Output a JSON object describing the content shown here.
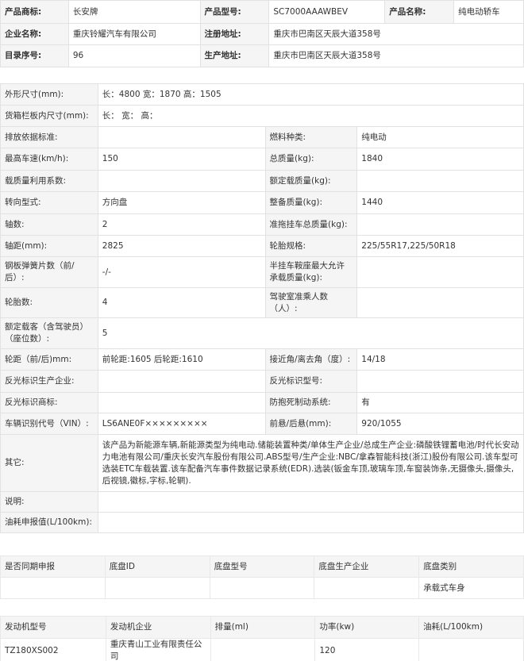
{
  "product": {
    "trademark_label": "产品商标:",
    "trademark": "长安牌",
    "model_label": "产品型号:",
    "model": "SC7000AAAWBEV",
    "name_label": "产品名称:",
    "name": "纯电动轿车",
    "company_label": "企业名称:",
    "company": "重庆铃耀汽车有限公司",
    "reg_addr_label": "注册地址:",
    "reg_addr": "重庆市巴南区天辰大道358号",
    "catalog_label": "目录序号:",
    "catalog": "96",
    "prod_addr_label": "生产地址:",
    "prod_addr": "重庆市巴南区天辰大道358号"
  },
  "params": {
    "dims_label": "外形尺寸(mm):",
    "dims": "长：4800 宽：1870 高：1505",
    "cargo_label": "货箱栏板内尺寸(mm):",
    "cargo": "长：   宽：   高：",
    "emission_label": "排放依据标准:",
    "emission": "",
    "fuel_label": "燃料种类:",
    "fuel": "纯电动",
    "speed_label": "最高车速(km/h):",
    "speed": "150",
    "total_mass_label": "总质量(kg):",
    "total_mass": "1840",
    "load_util_label": "载质量利用系数:",
    "load_util": "",
    "rated_load_label": "额定载质量(kg):",
    "rated_load": "",
    "steering_label": "转向型式:",
    "steering": "方向盘",
    "curb_label": "整备质量(kg):",
    "curb": "1440",
    "axles_label": "轴数:",
    "axles": "2",
    "trailer_label": "准拖挂车总质量(kg):",
    "trailer": "",
    "wheelbase_label": "轴距(mm):",
    "wheelbase": "2825",
    "tire_spec_label": "轮胎规格:",
    "tire_spec": "225/55R17,225/50R18",
    "spring_label": "钢板弹簧片数（前/后）:",
    "spring": "-/-",
    "semi_label": "半挂车鞍座最大允许承载质量(kg):",
    "semi": "",
    "tires_label": "轮胎数:",
    "tires": "4",
    "cab_label": "驾驶室准乘人数（人）:",
    "cab": "",
    "seats_label": "额定载客（含驾驶员）（座位数）:",
    "seats": "5",
    "track_label": "轮距（前/后)mm:",
    "track": "前轮距:1605 后轮距:1610",
    "angle_label": "接近角/离去角（度）:",
    "angle": "14/18",
    "refl_prod_label": "反光标识生产企业:",
    "refl_prod": "",
    "refl_model_label": "反光标识型号:",
    "refl_model": "",
    "refl_mark_label": "反光标识商标:",
    "refl_mark": "",
    "abs_label": "防抱死制动系统:",
    "abs": "有",
    "vin_label": "车辆识别代号（VIN）:",
    "vin": "LS6ANE0F×××××××××",
    "overhang_label": "前悬/后悬(mm):",
    "overhang": "920/1055",
    "other_label": "其它:",
    "other": "该产品为新能源车辆,新能源类型为纯电动.储能装置种类/单体生产企业/总成生产企业:磷酸铁锂蓄电池/时代长安动力电池有限公司/重庆长安汽车股份有限公司.ABS型号/生产企业:NBC/拿森智能科技(浙江)股份有限公司.该车型可选装ETC车载装置.该车配备汽车事件数据记录系统(EDR).选装(钣金车顶,玻璃车顶,车窗装饰条,无摄像头,摄像头,后视镜,徽标,字标,轮辋).",
    "note_label": "说明:",
    "note": "",
    "fuel_cons_label": "油耗申报值(L/100km):",
    "fuel_cons": ""
  },
  "chassis": {
    "headers": [
      "是否同期申报",
      "底盘ID",
      "底盘型号",
      "底盘生产企业",
      "底盘类别"
    ],
    "row": [
      "",
      "",
      "",
      "",
      "承载式车身"
    ]
  },
  "engine": {
    "headers": [
      "发动机型号",
      "发动机企业",
      "排量(ml)",
      "功率(kw)",
      "油耗(L/100km)"
    ],
    "row": [
      "TZ180XS002",
      "重庆青山工业有限责任公司",
      "",
      "120",
      ""
    ]
  }
}
